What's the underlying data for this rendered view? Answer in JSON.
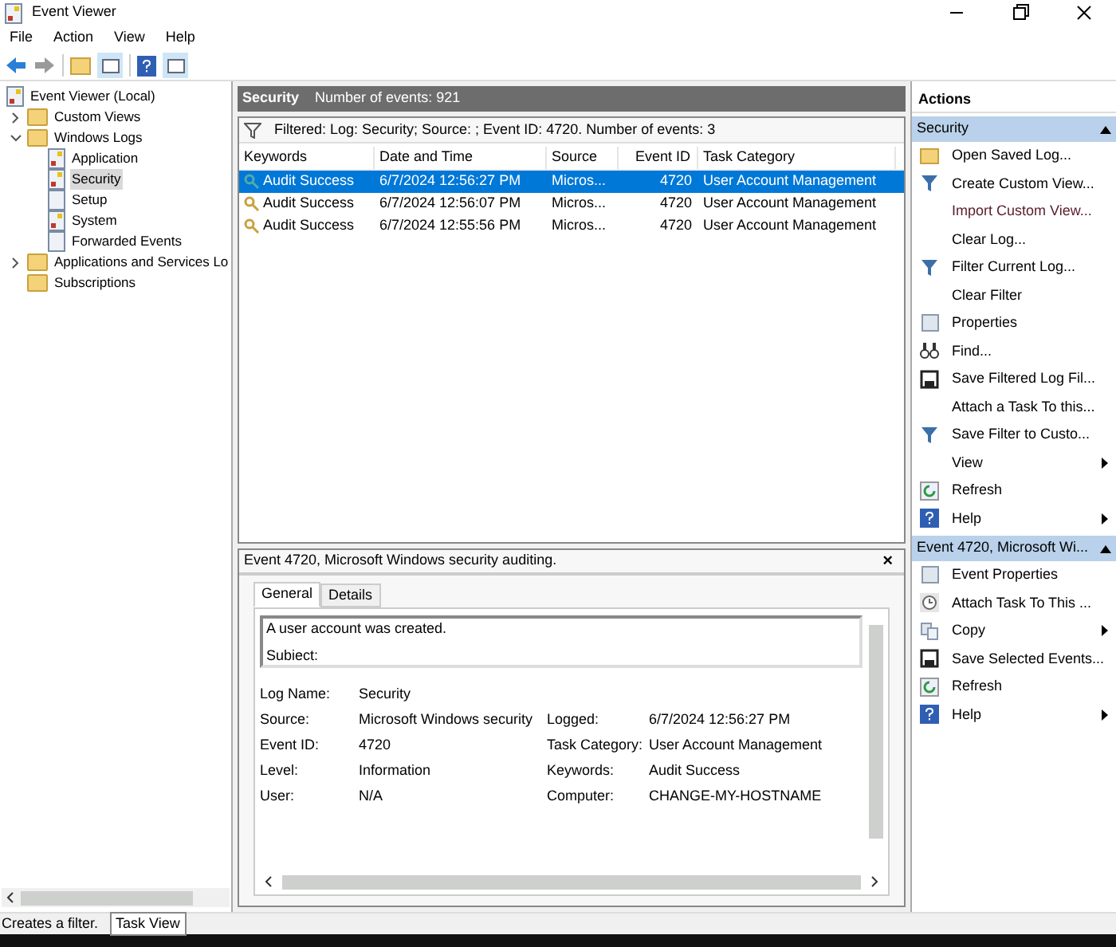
{
  "window": {
    "title": "Event Viewer"
  },
  "menu": [
    "File",
    "Action",
    "View",
    "Help"
  ],
  "tree": [
    {
      "label": "Event Viewer (Local)",
      "expanded": true,
      "selected": false,
      "children": [
        {
          "label": "Custom Views",
          "expanded": false,
          "selected": false
        },
        {
          "label": "Windows Logs",
          "expanded": true,
          "selected": false,
          "children": [
            {
              "label": "Application",
              "selected": false
            },
            {
              "label": "Security",
              "selected": true
            },
            {
              "label": "Setup",
              "selected": false
            },
            {
              "label": "System",
              "selected": false
            },
            {
              "label": "Forwarded Events",
              "selected": false
            }
          ]
        },
        {
          "label": "Applications and Services Lo",
          "expanded": false,
          "selected": false
        },
        {
          "label": "Subscriptions",
          "selected": false
        }
      ]
    }
  ],
  "log_header": {
    "title": "Security",
    "count": "Number of events: 921"
  },
  "filter_text": "Filtered: Log: Security; Source: ; Event ID: 4720. Number of events: 3",
  "table": {
    "columns": [
      "Keywords",
      "Date and Time",
      "Source",
      "Event ID",
      "Task Category"
    ],
    "rows": [
      {
        "cells": [
          "Audit Success",
          "6/7/2024 12:56:27 PM",
          "Micros...",
          "4720",
          "User Account Management"
        ],
        "selected": true
      },
      {
        "cells": [
          "Audit Success",
          "6/7/2024 12:56:07 PM",
          "Micros...",
          "4720",
          "User Account Management"
        ],
        "selected": false
      },
      {
        "cells": [
          "Audit Success",
          "6/7/2024 12:55:56 PM",
          "Micros...",
          "4720",
          "User Account Management"
        ],
        "selected": false
      }
    ]
  },
  "detail": {
    "title": "Event 4720, Microsoft Windows security auditing.",
    "close": "×",
    "tabs": [
      {
        "label": "General",
        "selected": true
      },
      {
        "label": "Details",
        "selected": false
      }
    ],
    "message": [
      "A user account was created.",
      "Subiect:"
    ],
    "fields": [
      {
        "label": "Log Name:",
        "value": "Security"
      },
      {
        "label": "Source:",
        "value": "Microsoft Windows security",
        "label2": "Logged:",
        "value2": "6/7/2024 12:56:27 PM"
      },
      {
        "label": "Event ID:",
        "value": "4720",
        "label2": "Task Category:",
        "value2": "User Account Management"
      },
      {
        "label": "Level:",
        "value": "Information",
        "label2": "Keywords:",
        "value2": "Audit Success"
      },
      {
        "label": "User:",
        "value": "N/A",
        "label2": "Computer:",
        "value2": "CHANGE-MY-HOSTNAME"
      }
    ]
  },
  "actions": {
    "title": "Actions",
    "sections": [
      {
        "title": "Security",
        "items": [
          {
            "label": "Open Saved Log...",
            "submenu": false
          },
          {
            "label": "Create Custom View...",
            "submenu": false
          },
          {
            "label": "Import Custom View...",
            "submenu": false
          },
          {
            "label": "Clear Log...",
            "submenu": false
          },
          {
            "label": "Filter Current Log...",
            "submenu": false
          },
          {
            "label": "Clear Filter",
            "submenu": false
          },
          {
            "label": "Properties",
            "submenu": false
          },
          {
            "label": "Find...",
            "submenu": false
          },
          {
            "label": "Save Filtered Log Fil...",
            "submenu": false
          },
          {
            "label": "Attach a Task To this...",
            "submenu": false
          },
          {
            "label": "Save Filter to Custo...",
            "submenu": false
          },
          {
            "label": "View",
            "submenu": true
          },
          {
            "label": "Refresh",
            "submenu": false
          },
          {
            "label": "Help",
            "submenu": true
          }
        ]
      },
      {
        "title": "Event 4720, Microsoft Wi...",
        "items": [
          {
            "label": "Event Properties",
            "submenu": false
          },
          {
            "label": "Attach Task To This ...",
            "submenu": false
          },
          {
            "label": "Copy",
            "submenu": true
          },
          {
            "label": "Save Selected Events...",
            "submenu": false
          },
          {
            "label": "Refresh",
            "submenu": false
          },
          {
            "label": "Help",
            "submenu": true
          }
        ]
      }
    ]
  },
  "status_bar": {
    "text": "Creates a filter.",
    "tooltip": "Task View"
  }
}
